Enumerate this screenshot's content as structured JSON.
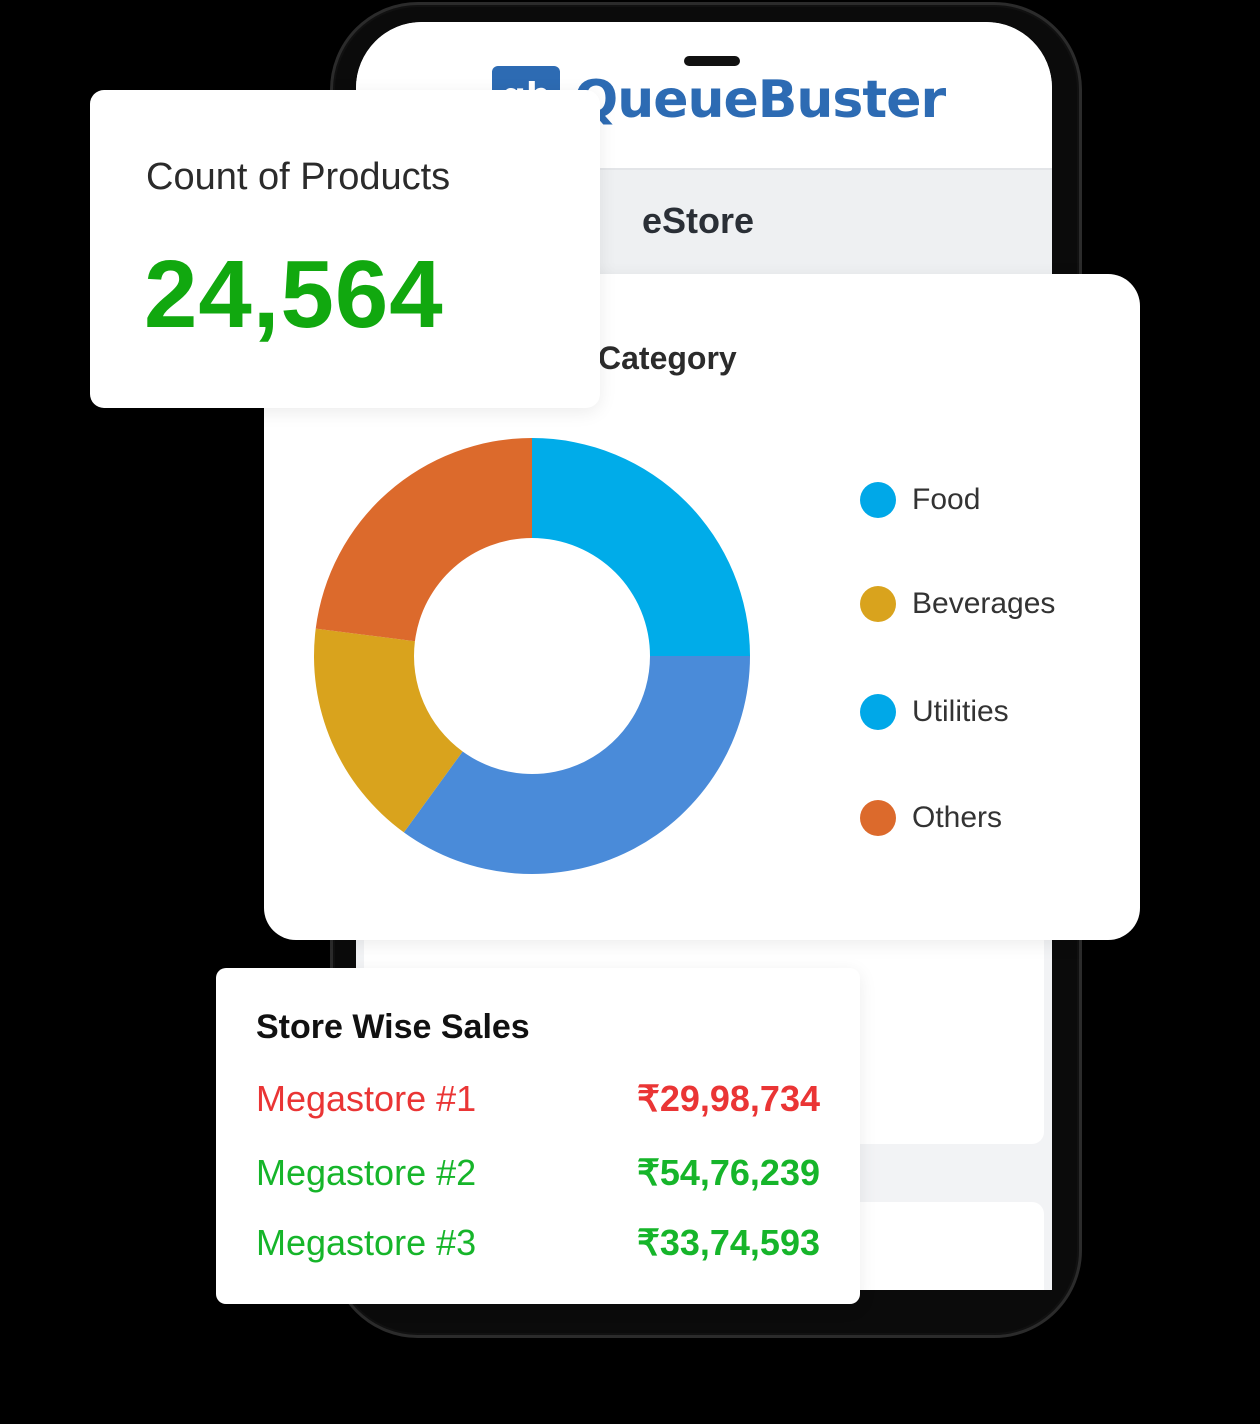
{
  "app": {
    "brand_mark": "qb",
    "brand_name": "QueueBuster",
    "screen_title": "eStore"
  },
  "count_card": {
    "label": "Count of Products",
    "value": "24,564",
    "value_color": "#11a80f"
  },
  "category_card": {
    "title": "Category",
    "legend": [
      {
        "label": "Food",
        "color": "#00a8e8"
      },
      {
        "label": "Beverages",
        "color": "#d9a31d"
      },
      {
        "label": "Utilities",
        "color": "#00a8e8"
      },
      {
        "label": "Others",
        "color": "#dc6a2c"
      }
    ]
  },
  "chart_data": {
    "type": "pie",
    "title": "Category",
    "donut": true,
    "categories": [
      "Food",
      "Beverages",
      "Utilities",
      "Others"
    ],
    "values": [
      25,
      17,
      35,
      23
    ],
    "slice_order_clockwise_from_top": [
      "Food",
      "Utilities",
      "Beverages",
      "Others"
    ],
    "slice_colors": {
      "Food": "#00ace9",
      "Utilities": "#4a8bd9",
      "Beverages": "#d9a31d",
      "Others": "#dc6a2c"
    },
    "legend_position": "right"
  },
  "sales_card": {
    "title": "Store Wise Sales",
    "rows": [
      {
        "store": "Megastore #1",
        "amount": "₹29,98,734",
        "color": "#ea3535"
      },
      {
        "store": "Megastore #2",
        "amount": "₹54,76,239",
        "color": "#16b52a"
      },
      {
        "store": "Megastore #3",
        "amount": "₹33,74,593",
        "color": "#16b52a"
      }
    ]
  }
}
